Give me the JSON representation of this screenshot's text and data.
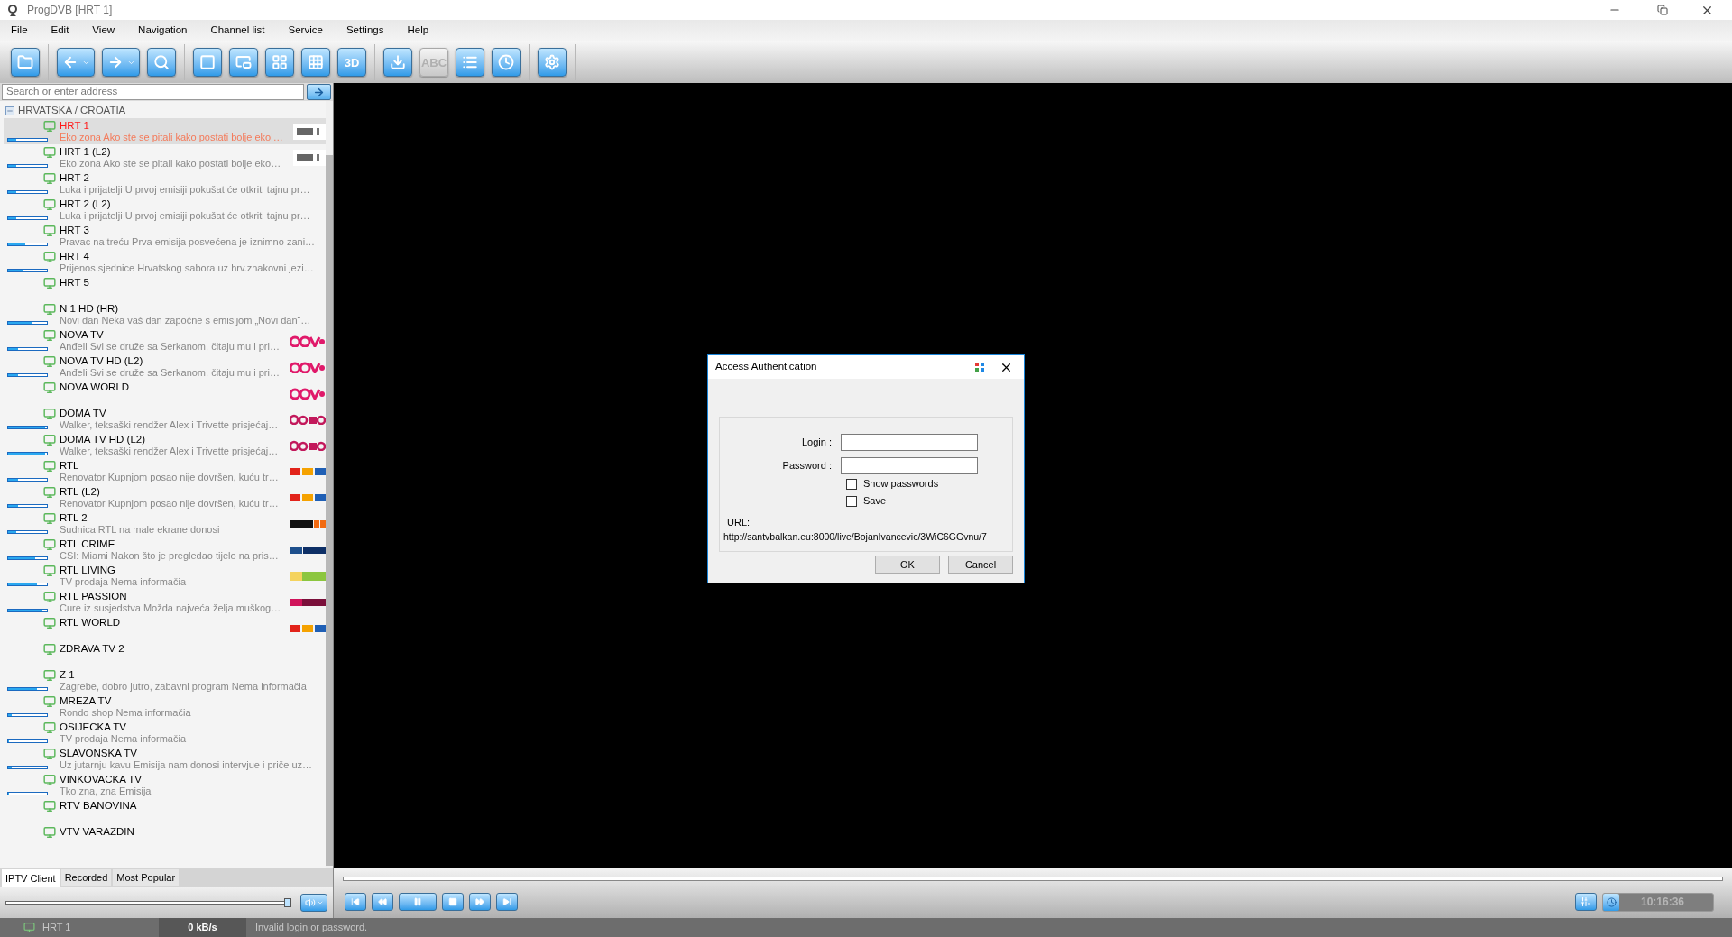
{
  "window": {
    "title": "ProgDVB [HRT 1]"
  },
  "menu": [
    "File",
    "Edit",
    "View",
    "Navigation",
    "Channel list",
    "Service",
    "Settings",
    "Help"
  ],
  "toolbar": [
    [
      {
        "kind": "folder",
        "disabled": false
      }
    ],
    [
      {
        "kind": "back",
        "disabled": false
      },
      {
        "kind": "forward",
        "disabled": false
      },
      {
        "kind": "search",
        "disabled": false
      }
    ],
    [
      {
        "kind": "single",
        "disabled": false
      },
      {
        "kind": "pip",
        "disabled": false
      },
      {
        "kind": "quad",
        "disabled": false
      },
      {
        "kind": "mosaic",
        "disabled": false
      },
      {
        "kind": "label",
        "label": "3D",
        "disabled": false
      }
    ],
    [
      {
        "kind": "record",
        "disabled": false
      },
      {
        "kind": "subtitles",
        "label": "ABC",
        "disabled": true
      },
      {
        "kind": "list",
        "disabled": false
      },
      {
        "kind": "clock",
        "disabled": false
      }
    ],
    [
      {
        "kind": "settings",
        "disabled": false
      }
    ]
  ],
  "search": {
    "placeholder": "Search or enter address"
  },
  "group": {
    "label": "HRVATSKA / CROATIA",
    "expanded": true
  },
  "channels": [
    {
      "name": "HRT 1",
      "desc": "Eko zona Ako ste se pitali kako postati bolje ekol…",
      "level": 0.2,
      "logo": {
        "kind": "hrt"
      },
      "selected": true
    },
    {
      "name": "HRT 1 (L2)",
      "desc": "Eko zona Ako ste se pitali kako postati bolje eko…",
      "level": 0.22,
      "logo": {
        "kind": "hrt"
      },
      "selected": false
    },
    {
      "name": "HRT 2",
      "desc": "Luka i prijatelji U prvoj emisiji pokušat će otkriti tajnu pr…",
      "level": 0.2,
      "selected": false
    },
    {
      "name": "HRT 2 (L2)",
      "desc": "Luka i prijatelji U prvoj emisiji pokušat će otkriti tajnu pr…",
      "level": 0.2,
      "selected": false
    },
    {
      "name": "HRT 3",
      "desc": "Pravac na treću Prva emisija posvećena je iznimno zani…",
      "level": 0.45,
      "selected": false
    },
    {
      "name": "HRT 4",
      "desc": "Prijenos sjednice Hrvatskog sabora uz hrv.znakovni jezi…",
      "level": 0.4,
      "selected": false
    },
    {
      "name": "HRT 5",
      "selected": false
    },
    {
      "name": "N 1  HD (HR)",
      "desc": "Novi dan Neka vaš dan započne s emisijom „Novi dan“…",
      "level": 0.62,
      "selected": false
    },
    {
      "name": "NOVA TV",
      "desc": "Anđeli Svi se druže sa Serkanom, čitaju mu i pri…",
      "level": 0.25,
      "logo": {
        "kind": "nova"
      },
      "selected": false
    },
    {
      "name": "NOVA TV HD (L2)",
      "desc": "Anđeli Svi se druže sa Serkanom, čitaju mu i pri…",
      "level": 0.25,
      "logo": {
        "kind": "nova"
      },
      "selected": false
    },
    {
      "name": "NOVA WORLD",
      "logo": {
        "kind": "nova"
      },
      "selected": false
    },
    {
      "name": "DOMA TV",
      "desc": "Walker, teksaški rendžer Alex i Trivette prisjećaj…",
      "level": 0.95,
      "logo": {
        "kind": "doma"
      },
      "selected": false
    },
    {
      "name": "DOMA TV HD (L2)",
      "desc": "Walker, teksaški rendžer Alex i Trivette prisjećaj…",
      "level": 0.95,
      "logo": {
        "kind": "doma"
      },
      "selected": false
    },
    {
      "name": "RTL",
      "desc": "Renovator Kupnjom posao nije dovršen, kuću tr…",
      "level": 0.25,
      "logo": {
        "kind": "rtl"
      },
      "selected": false
    },
    {
      "name": "RTL (L2)",
      "desc": "Renovator Kupnjom posao nije dovršen, kuću tr…",
      "level": 0.25,
      "logo": {
        "kind": "rtl"
      },
      "selected": false
    },
    {
      "name": "RTL 2",
      "desc": "Sudnica RTL na male ekrane donosi",
      "level": 0.22,
      "logo": {
        "kind": "rtl2"
      },
      "selected": false
    },
    {
      "name": "RTL CRIME",
      "desc": "CSI: Miami Nakon što je pregledao tijelo na pris…",
      "level": 0.7,
      "logo": {
        "kind": "crime"
      },
      "selected": false
    },
    {
      "name": "RTL LIVING",
      "desc": "TV prodaja Nema informačia",
      "level": 0.75,
      "logo": {
        "kind": "living"
      },
      "selected": false
    },
    {
      "name": "RTL PASSION",
      "desc": "Cure iz susjedstva Možda najveća želja muškog…",
      "level": 0.88,
      "logo": {
        "kind": "passion"
      },
      "selected": false
    },
    {
      "name": "RTL WORLD",
      "logo": {
        "kind": "rtl"
      },
      "selected": false
    },
    {
      "name": "ZDRAVA TV 2",
      "selected": false
    },
    {
      "name": "Z 1",
      "desc": "Zagrebe, dobro jutro, zabavni program Nema informačia",
      "level": 0.75,
      "selected": false
    },
    {
      "name": "MREZA TV",
      "desc": "Rondo shop Nema informačia",
      "level": 0.1,
      "selected": false
    },
    {
      "name": "OSIJECKA TV",
      "desc": "TV prodaja Nema informačia",
      "level": 0.02,
      "selected": false
    },
    {
      "name": "SLAVONSKA TV",
      "desc": "Uz jutarnju kavu Emisija nam donosi intervjue i priče uz…",
      "level": 0.1,
      "selected": false
    },
    {
      "name": "VINKOVACKA TV",
      "desc": "Tko zna, zna Emisija",
      "level": 0.03,
      "selected": false
    },
    {
      "name": "RTV BANOVINA",
      "selected": false
    },
    {
      "name": "VTV VARAZDIN",
      "selected": false
    }
  ],
  "tabs": [
    {
      "label": "IPTV Client",
      "selected": true
    },
    {
      "label": "Recorded",
      "selected": false
    },
    {
      "label": "Most Popular",
      "selected": false
    }
  ],
  "volume": {
    "level": 1.0
  },
  "player_buttons": [
    {
      "kind": "first"
    },
    {
      "kind": "rewind"
    },
    {
      "kind": "pause"
    },
    {
      "kind": "stop"
    },
    {
      "kind": "forward"
    },
    {
      "kind": "last"
    }
  ],
  "clock": "10:16:36",
  "dialog": {
    "title": "Access Authentication",
    "login_label": "Login :",
    "password_label": "Password :",
    "checkboxes": [
      {
        "label": "Show passwords",
        "checked": false
      },
      {
        "label": "Save",
        "checked": false
      }
    ],
    "url_label": "URL:",
    "url": "http://santvbalkan.eu:8000/live/BojanIvancevic/3WiC6GGvnu/7",
    "buttons": [
      "OK",
      "Cancel"
    ]
  },
  "status_bar": {
    "channel": "HRT 1",
    "rate": "0 kB/s",
    "message": "Invalid login or password."
  }
}
